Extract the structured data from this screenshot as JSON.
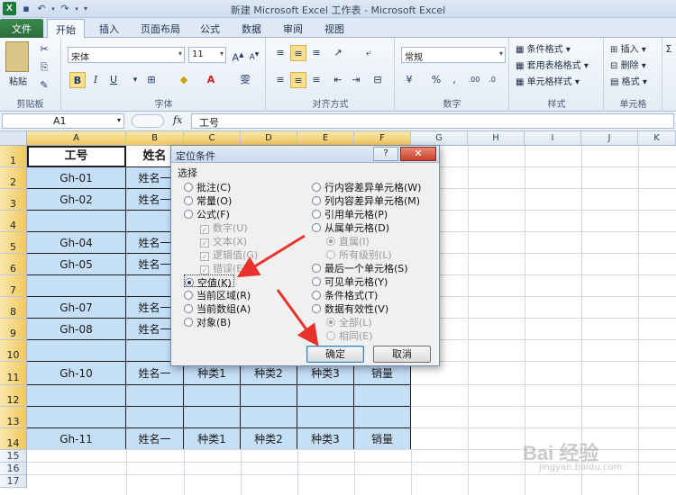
{
  "window": {
    "title": "新建 Microsoft Excel 工作表 - Microsoft Excel",
    "logo_text": "X"
  },
  "tabs": [
    "文件",
    "开始",
    "插入",
    "页面布局",
    "公式",
    "数据",
    "审阅",
    "视图"
  ],
  "ribbon": {
    "groups": {
      "clipboard": "剪贴板",
      "font": "字体",
      "alignment": "对齐方式",
      "number": "数字",
      "styles": "样式",
      "cells": "单元格"
    },
    "paste_label": "粘贴",
    "font_name": "宋体",
    "font_size": "11",
    "number_format": "常规",
    "conditional_format": "条件格式",
    "table_format": "套用表格格式",
    "cell_styles": "单元格样式",
    "insert": "插入",
    "delete": "删除",
    "format": "格式",
    "bold": "B",
    "italic": "I",
    "underline": "U"
  },
  "formula_bar": {
    "name_box": "A1",
    "fx": "fx",
    "value": "工号"
  },
  "columns": [
    "A",
    "B",
    "C",
    "D",
    "E",
    "F",
    "G",
    "H",
    "I",
    "J",
    "K"
  ],
  "rows": [
    "1",
    "2",
    "3",
    "4",
    "5",
    "6",
    "7",
    "8",
    "9",
    "10",
    "11",
    "12",
    "13",
    "14",
    "15",
    "16",
    "17"
  ],
  "sheet": {
    "header_a": "工号",
    "header_b": "姓名",
    "a": [
      "Gh-01",
      "Gh-02",
      "",
      "Gh-04",
      "Gh-05",
      "",
      "Gh-07",
      "Gh-08",
      "",
      "Gh-10",
      "",
      "",
      "Gh-11"
    ],
    "b": [
      "姓名一",
      "姓名一",
      "",
      "姓名一",
      "姓名一",
      "",
      "姓名一",
      "姓名一",
      "",
      "姓名一",
      "",
      "",
      "姓名一"
    ],
    "row11": [
      "种类1",
      "种类2",
      "种类3",
      "销量"
    ],
    "row14": [
      "种类1",
      "种类2",
      "种类3",
      "销量"
    ]
  },
  "dialog": {
    "title": "定位条件",
    "help": "?",
    "close": "✕",
    "section": "选择",
    "left_options": [
      {
        "label": "批注(C)",
        "type": "radio",
        "checked": false,
        "disabled": false
      },
      {
        "label": "常量(O)",
        "type": "radio",
        "checked": false,
        "disabled": false
      },
      {
        "label": "公式(F)",
        "type": "radio",
        "checked": false,
        "disabled": false
      },
      {
        "label": "数字(U)",
        "type": "check",
        "checked": true,
        "disabled": true
      },
      {
        "label": "文本(X)",
        "type": "check",
        "checked": true,
        "disabled": true
      },
      {
        "label": "逻辑值(G)",
        "type": "check",
        "checked": true,
        "disabled": true
      },
      {
        "label": "错误(E)",
        "type": "check",
        "checked": true,
        "disabled": true
      },
      {
        "label": "空值(K)",
        "type": "radio",
        "checked": true,
        "disabled": false
      },
      {
        "label": "当前区域(R)",
        "type": "radio",
        "checked": false,
        "disabled": false
      },
      {
        "label": "当前数组(A)",
        "type": "radio",
        "checked": false,
        "disabled": false
      },
      {
        "label": "对象(B)",
        "type": "radio",
        "checked": false,
        "disabled": false
      }
    ],
    "right_options": [
      {
        "label": "行内容差异单元格(W)",
        "type": "radio",
        "checked": false,
        "disabled": false
      },
      {
        "label": "列内容差异单元格(M)",
        "type": "radio",
        "checked": false,
        "disabled": false
      },
      {
        "label": "引用单元格(P)",
        "type": "radio",
        "checked": false,
        "disabled": false
      },
      {
        "label": "从属单元格(D)",
        "type": "radio",
        "checked": false,
        "disabled": false
      },
      {
        "label": "直属(I)",
        "type": "radio",
        "checked": true,
        "disabled": true
      },
      {
        "label": "所有级别(L)",
        "type": "radio",
        "checked": false,
        "disabled": true
      },
      {
        "label": "最后一个单元格(S)",
        "type": "radio",
        "checked": false,
        "disabled": false
      },
      {
        "label": "可见单元格(Y)",
        "type": "radio",
        "checked": false,
        "disabled": false
      },
      {
        "label": "条件格式(T)",
        "type": "radio",
        "checked": false,
        "disabled": false
      },
      {
        "label": "数据有效性(V)",
        "type": "radio",
        "checked": false,
        "disabled": false
      },
      {
        "label": "全部(L)",
        "type": "radio",
        "checked": true,
        "disabled": true
      },
      {
        "label": "相同(E)",
        "type": "radio",
        "checked": false,
        "disabled": true
      }
    ],
    "ok": "确定",
    "cancel": "取消"
  },
  "colors": {
    "selection_fill": "#c5dff7",
    "arrow": "#e8322a"
  },
  "watermark": {
    "text": "Bai 经验",
    "url": "jingyan.baidu.com"
  }
}
